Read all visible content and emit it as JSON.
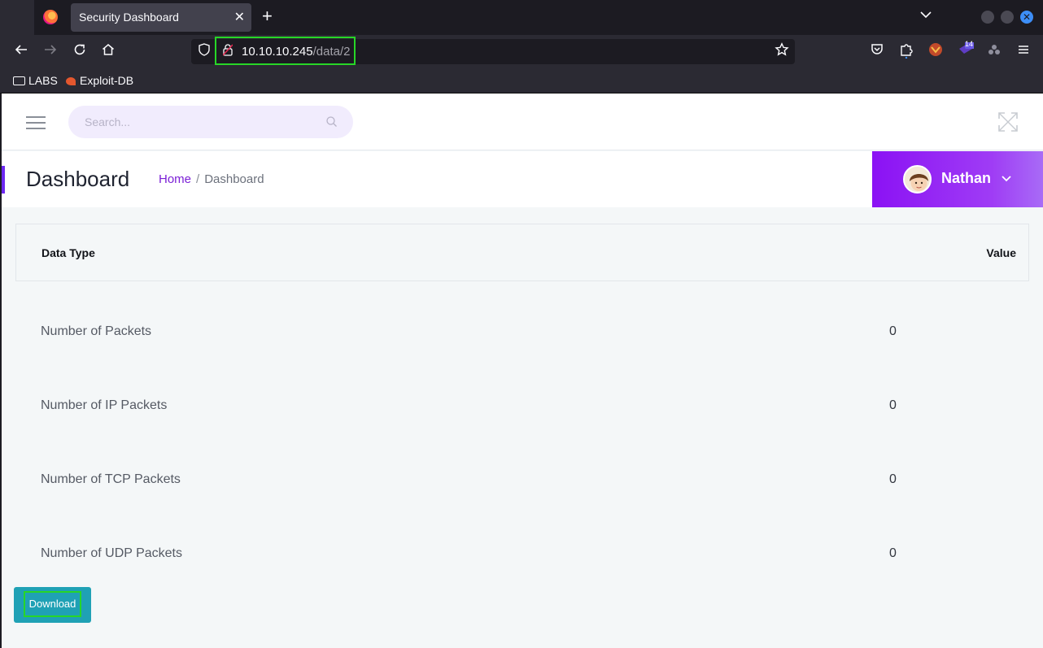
{
  "browser": {
    "tab_title": "Security Dashboard",
    "url_host": "10.10.10.245",
    "url_path": "/data/2",
    "extensions_badge": "14",
    "bookmarks": [
      {
        "label": "LABS",
        "icon": "folder-icon"
      },
      {
        "label": "Exploit-DB",
        "icon": "exploit-db-icon"
      }
    ]
  },
  "topbar": {
    "search_placeholder": "Search..."
  },
  "header": {
    "title": "Dashboard",
    "breadcrumb": {
      "home": "Home",
      "separator": "/",
      "current": "Dashboard"
    },
    "user_name": "Nathan"
  },
  "table": {
    "columns": [
      "Data Type",
      "Value"
    ],
    "rows": [
      {
        "label": "Number of Packets",
        "value": "0"
      },
      {
        "label": "Number of IP Packets",
        "value": "0"
      },
      {
        "label": "Number of TCP Packets",
        "value": "0"
      },
      {
        "label": "Number of UDP Packets",
        "value": "0"
      }
    ]
  },
  "actions": {
    "download_label": "Download"
  },
  "colors": {
    "accent": "#8b12f4",
    "download_button": "#1fa1b5",
    "highlight_box": "#27d627"
  }
}
